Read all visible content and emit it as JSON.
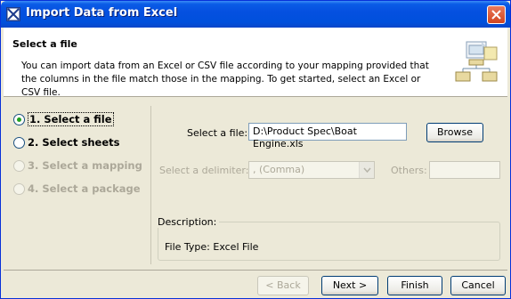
{
  "window": {
    "title": "Import Data from Excel"
  },
  "header": {
    "title": "Select a file",
    "description": "You can import data from an Excel or CSV file according to your mapping provided that the columns in the file match those in the mapping. To get started, select an Excel or CSV file."
  },
  "steps": [
    {
      "label": "1. Select a file",
      "state": "checked"
    },
    {
      "label": "2. Select sheets",
      "state": "enabled"
    },
    {
      "label": "3. Select a mapping",
      "state": "disabled"
    },
    {
      "label": "4. Select a package",
      "state": "disabled"
    }
  ],
  "form": {
    "file_label": "Select a file:",
    "file_value": "D:\\Product Spec\\Boat Engine.xls",
    "browse_label": "Browse",
    "delimiter_label": "Select a delimiter:",
    "delimiter_value": ", (Comma)",
    "others_label": "Others:",
    "others_value": "",
    "description_legend": "Description:",
    "description_text": "File Type: Excel File"
  },
  "footer": {
    "back_label": "< Back",
    "next_label": "Next >",
    "finish_label": "Finish",
    "cancel_label": "Cancel"
  },
  "colors": {
    "titlebar": "#0050dc",
    "window_bg": "#ece9d8",
    "checked_radio": "#21a121"
  }
}
